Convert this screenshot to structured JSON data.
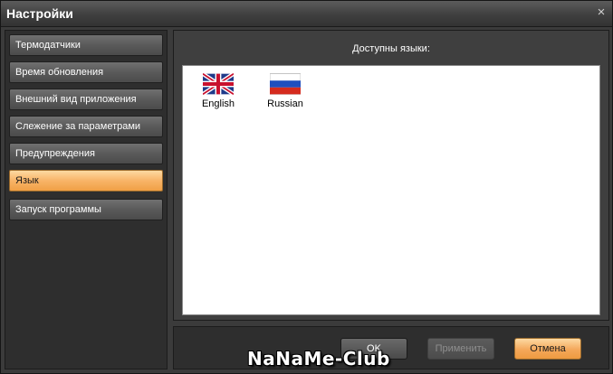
{
  "window": {
    "title": "Настройки",
    "close_icon": "×"
  },
  "sidebar": {
    "items": [
      {
        "label": "Термодатчики",
        "active": false
      },
      {
        "label": "Время обновления",
        "active": false
      },
      {
        "label": "Внешний вид приложения",
        "active": false
      },
      {
        "label": "Слежение за параметрами",
        "active": false
      },
      {
        "label": "Предупреждения",
        "active": false
      },
      {
        "label": "Язык",
        "active": true
      },
      {
        "label": "Запуск программы",
        "active": false
      }
    ]
  },
  "language_panel": {
    "header": "Доступны языки:",
    "languages": [
      {
        "label": "English",
        "flag": "uk-flag-icon"
      },
      {
        "label": "Russian",
        "flag": "russia-flag-icon"
      }
    ]
  },
  "footer": {
    "ok_label": "OK",
    "apply_label": "Применить",
    "cancel_label": "Отмена",
    "apply_enabled": false
  },
  "watermark": "NaNaMe-Club",
  "colors": {
    "accent": "#f8b468",
    "active_text": "#1a1a1a",
    "disabled_text": "#8e8e8e"
  }
}
